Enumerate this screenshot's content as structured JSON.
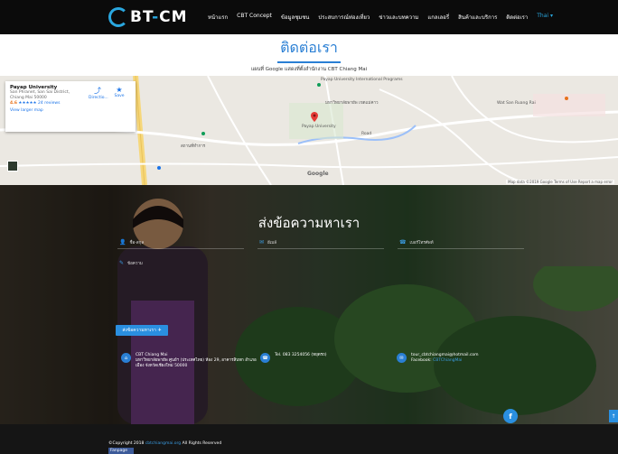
{
  "brand": {
    "prefix": "BT",
    "dash": "-",
    "suffix": "CM"
  },
  "nav": {
    "items": [
      "หน้าแรก",
      "CBT Concept",
      "ข้อมูลชุมชน",
      "ประสบการณ์ท่องเที่ยว",
      "ข่าวและบทความ",
      "แกลเลอรี่",
      "สินค้าและบริการ",
      "ติดต่อเรา",
      "Thai ▾"
    ],
    "active_index": 7
  },
  "header": {
    "title": "ติดต่อเรา",
    "subtitle": "แผนที่ Google แสดงที่ตั้งสำนักงาน CBT Chiang Mai"
  },
  "map": {
    "place_name": "Payap University",
    "address": "San Phranet, San Sai District, Chiang Mai 50000",
    "rating": "4.6",
    "stars": "★★★★★",
    "reviews": "24 reviews",
    "view_larger": "View larger map",
    "directions": "Directio...",
    "save": "Save",
    "labels": {
      "university_intl": "Payap University International Programs",
      "christian_uni": "มหาวิทยาลัยพายัพ เขตแม่คาว",
      "payap_small": "Payap University",
      "temple": "Wat San Ruang Rai",
      "road": "Road",
      "north_label": "สถานที่ทำการ"
    },
    "footer": "Map data ©2019 Google  Terms of Use  Report a map error",
    "google": "Google"
  },
  "contact": {
    "title": "ส่งข้อความหาเรา",
    "name_placeholder": "ชื่อ-สกุล",
    "email_placeholder": "อีเมล์",
    "phone_placeholder": "เบอร์โทรศัพท์",
    "message_placeholder": "ข้อความ",
    "send_label": "ส่งข้อความหาเรา",
    "org_name": "CBT Chiang Mai",
    "org_address": "มหาวิทยาลัยพายัพ ศูนย์ฯ (ประเทศไทย) ห้อง 29, อาคารสิบหก อำเภอเมือง จังหวัดเชียงใหม่ 50000",
    "tel": "Tel. 083 3254056 (หยุดรถ)",
    "email": "tour_cbtchiangmai@hotmail.com",
    "facebook_label": "Facebook:",
    "facebook": "CBTChiangMai"
  },
  "footer": {
    "copyright": "©Copyright 2018",
    "site": "cbtchiangmai.org",
    "rights": "All Rights Reserved",
    "badge": "Fanpage"
  }
}
